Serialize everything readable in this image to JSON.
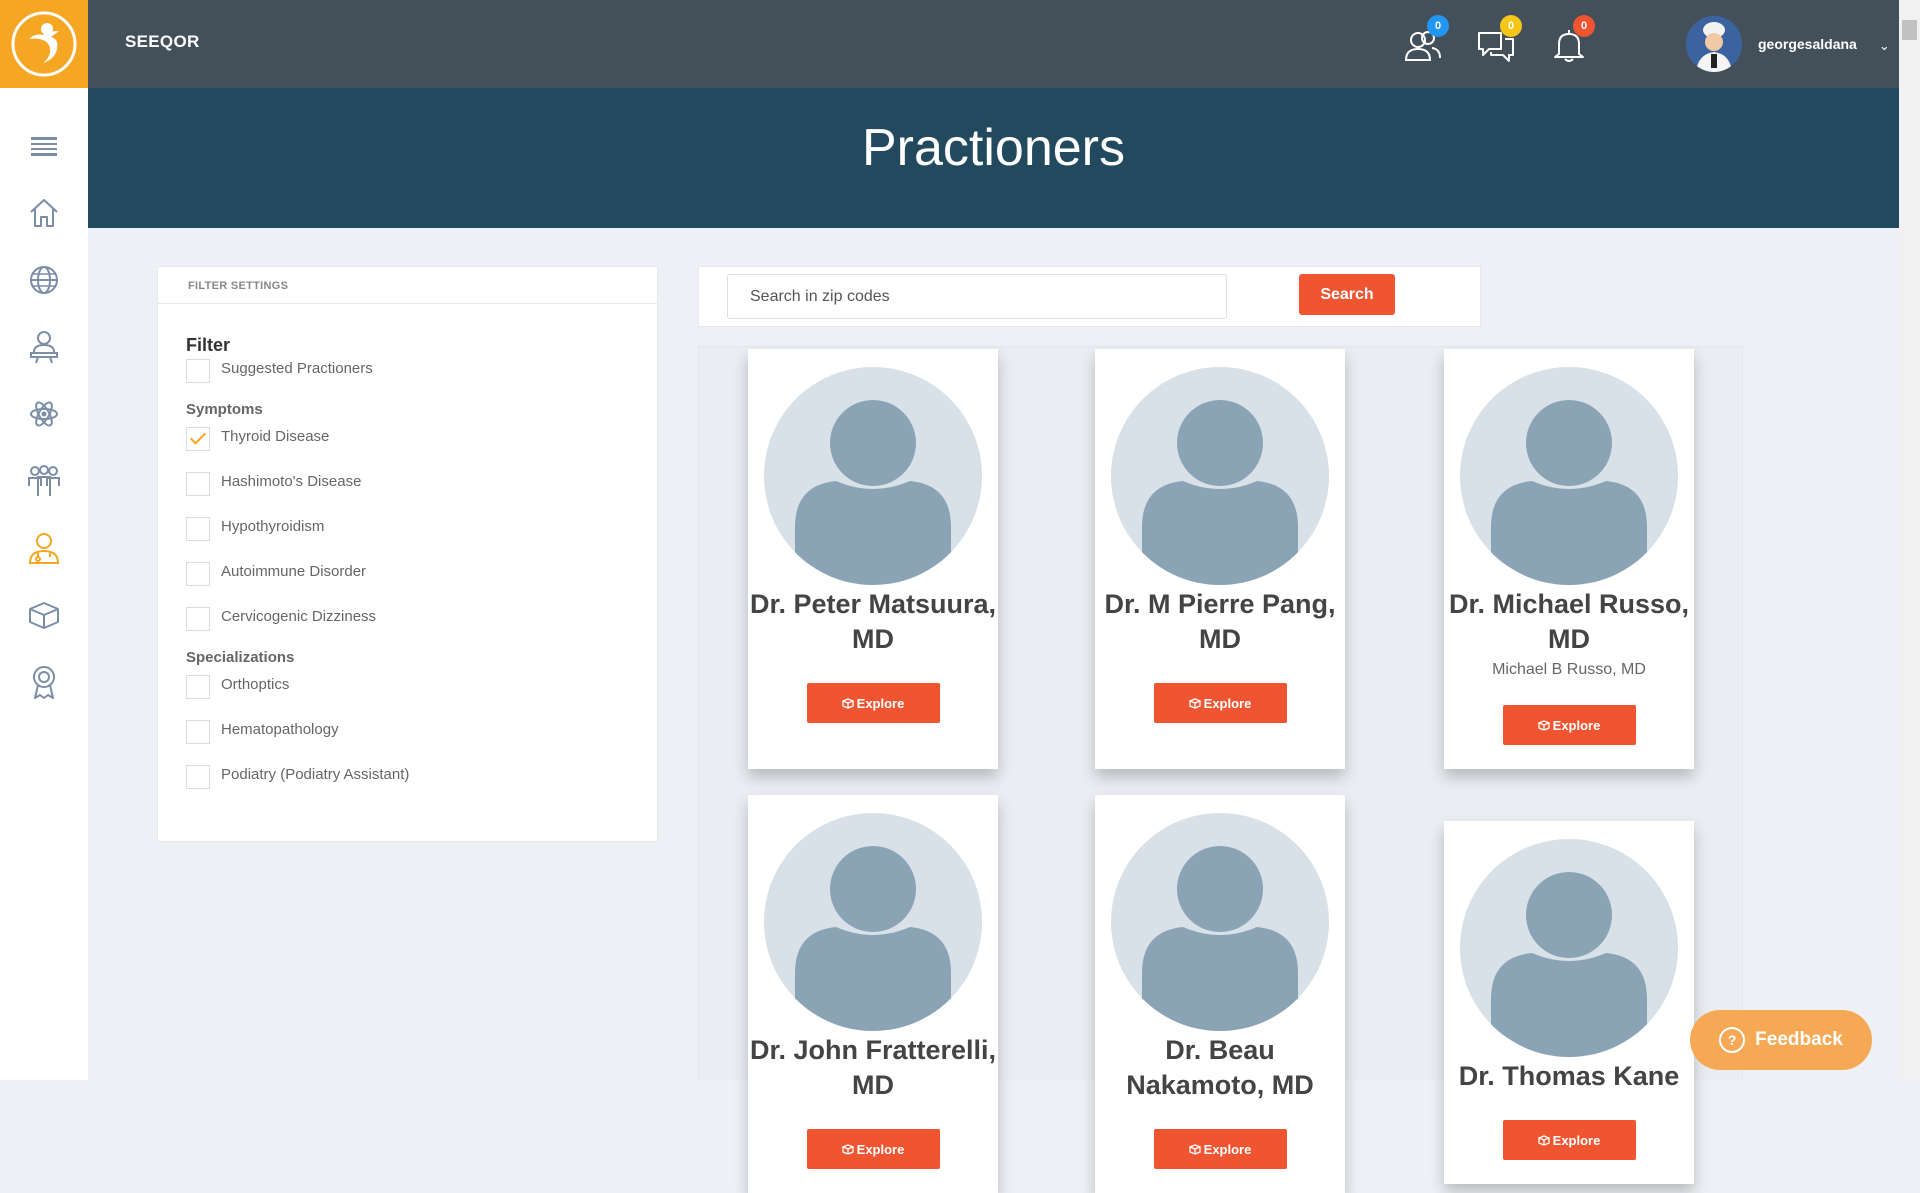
{
  "app": {
    "brand": "SEEQOR"
  },
  "header": {
    "icons": [
      {
        "name": "connections-icon",
        "count": "0",
        "badge_color": "#2196f3"
      },
      {
        "name": "messages-icon",
        "count": "0",
        "badge_color": "#f5c518"
      },
      {
        "name": "notifications-icon",
        "count": "0",
        "badge_color": "#f05532"
      }
    ],
    "username": "georgesaldana",
    "caret": "⌄"
  },
  "sidebar": {
    "items": [
      {
        "name": "menu-icon"
      },
      {
        "name": "home-icon"
      },
      {
        "name": "globe-icon"
      },
      {
        "name": "practitioner-icon"
      },
      {
        "name": "atom-icon"
      },
      {
        "name": "group-icon"
      },
      {
        "name": "doctor-icon",
        "active": true
      },
      {
        "name": "box-icon"
      },
      {
        "name": "award-icon"
      }
    ]
  },
  "page": {
    "title": "Practioners"
  },
  "filter": {
    "header": "FILTER SETTINGS",
    "title": "Filter",
    "suggested": {
      "label": "Suggested Practioners",
      "checked": false
    },
    "symptoms_title": "Symptoms",
    "symptoms": [
      {
        "label": "Thyroid Disease",
        "checked": true
      },
      {
        "label": "Hashimoto's Disease",
        "checked": false
      },
      {
        "label": "Hypothyroidism",
        "checked": false
      },
      {
        "label": "Autoimmune Disorder",
        "checked": false
      },
      {
        "label": "Cervicogenic Dizziness",
        "checked": false
      }
    ],
    "specializations_title": "Specializations",
    "specializations": [
      {
        "label": "Orthoptics",
        "checked": false
      },
      {
        "label": "Hematopathology",
        "checked": false
      },
      {
        "label": "Podiatry (Podiatry Assistant)",
        "checked": false
      }
    ]
  },
  "search": {
    "placeholder": "Search in zip codes",
    "button": "Search"
  },
  "practitioners": [
    {
      "name": "Dr. Peter Matsuura, MD",
      "subtitle": "",
      "explore": "Explore"
    },
    {
      "name": "Dr. M Pierre Pang, MD",
      "subtitle": "",
      "explore": "Explore"
    },
    {
      "name": "Dr. Michael Russo, MD",
      "subtitle": "Michael B Russo, MD",
      "explore": "Explore"
    },
    {
      "name": "Dr. John Fratterelli, MD",
      "subtitle": "",
      "explore": "Explore"
    },
    {
      "name": "Dr. Beau Nakamoto, MD",
      "subtitle": "",
      "explore": "Explore"
    },
    {
      "name": "Dr. Thomas Kane",
      "subtitle": "",
      "explore": "Explore"
    }
  ],
  "feedback": {
    "label": "Feedback",
    "icon": "?"
  }
}
